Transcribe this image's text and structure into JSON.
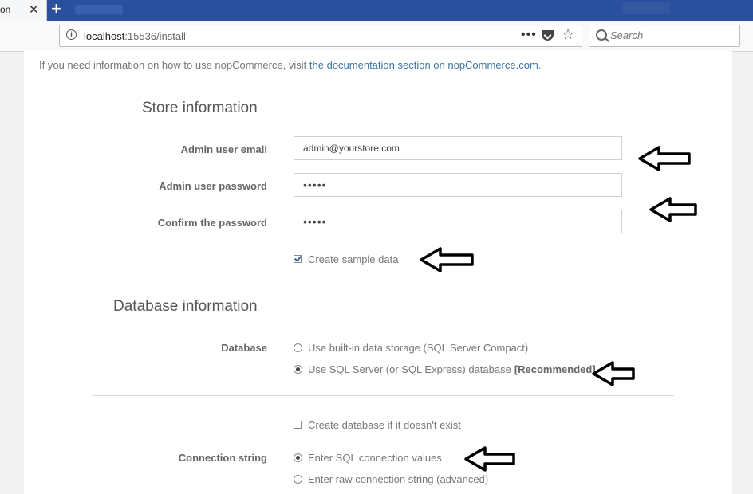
{
  "browser": {
    "tab_title": "on",
    "close_glyph": "✕",
    "new_tab_glyph": "+",
    "url_host": "localhost",
    "url_path": ":15536/install",
    "search_placeholder": "Search",
    "more_glyph": "•••",
    "star_glyph": "☆",
    "info_glyph": "i"
  },
  "intro": {
    "text": "If you need information on how to use nopCommerce, visit ",
    "link": "the documentation section on nopCommerce.com",
    "suffix": "."
  },
  "store": {
    "title": "Store information",
    "email_label": "Admin user email",
    "email_value": "admin@yourstore.com",
    "password_label": "Admin user password",
    "password_value": "•••••",
    "confirm_label": "Confirm the password",
    "confirm_value": "•••••",
    "sample_data_label": "Create sample data",
    "sample_data_checked": true
  },
  "database": {
    "title": "Database information",
    "label": "Database",
    "option_builtin": "Use built-in data storage (SQL Server Compact)",
    "option_sql": "Use SQL Server (or SQL Express) database",
    "option_sql_tag": "[Recommended]",
    "selected": "sql",
    "create_db_label": "Create database if it doesn't exist",
    "connection_label": "Connection string",
    "conn_option_values": "Enter SQL connection values",
    "conn_option_raw": "Enter raw connection string (advanced)"
  },
  "colors": {
    "tab_strip": "#2a4f9e",
    "link": "#3a76a8",
    "arrow_stroke": "#000000"
  }
}
